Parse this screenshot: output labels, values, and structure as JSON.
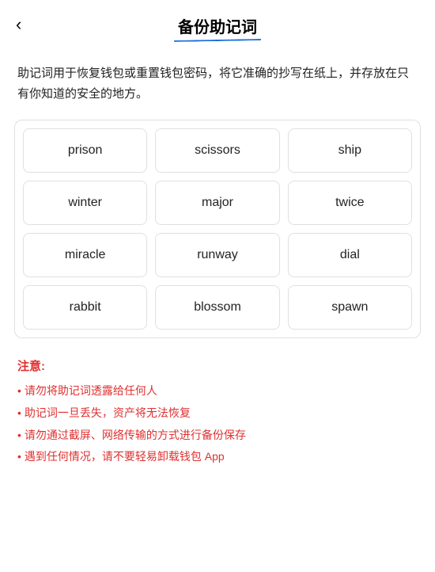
{
  "header": {
    "back_icon": "‹",
    "title": "备份助记词"
  },
  "description": "助记词用于恢复钱包或重置钱包密码，将它准确的抄写在纸上，并存放在只有你知道的安全的地方。",
  "mnemonic_grid": {
    "words": [
      "prison",
      "scissors",
      "ship",
      "winter",
      "major",
      "twice",
      "miracle",
      "runway",
      "dial",
      "rabbit",
      "blossom",
      "spawn"
    ]
  },
  "notice": {
    "title": "注意:",
    "items": [
      "请勿将助记词透露给任何人",
      "助记词一旦丢失，资产将无法恢复",
      "请勿通过截屏、网络传输的方式进行备份保存",
      "遇到任何情况，请不要轻易卸载钱包 App"
    ]
  }
}
